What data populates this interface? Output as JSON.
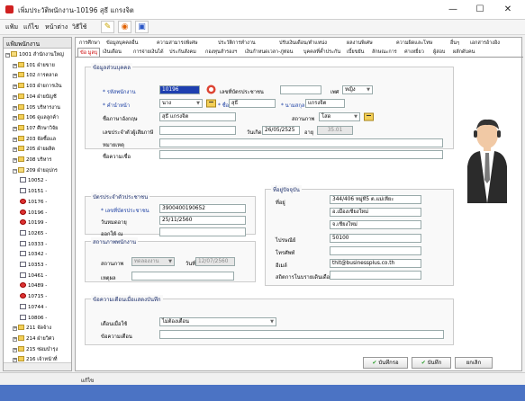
{
  "window": {
    "title": "เพิ่มประวัติพนักงาน-10196 สุธี แกรงจิต",
    "minimize": "—",
    "maximize": "☐",
    "close": "✕"
  },
  "menubar": {
    "items": [
      "แฟ้ม",
      "แก้ไข",
      "หน้าต่าง",
      "วิธีใช้"
    ]
  },
  "tree": {
    "header": "แฟ้มพนักงาน",
    "nodes": [
      {
        "label": "1001 สำนักงานใหญ่",
        "icon": "folder-open-icon"
      },
      {
        "label": "101 ฝ่ายขาย",
        "icon": "folder-icon"
      },
      {
        "label": "102 การตลาด",
        "icon": "folder-icon"
      },
      {
        "label": "103 ฝ่ายการเงิน",
        "icon": "folder-icon"
      },
      {
        "label": "104 ฝ่ายบัญชี",
        "icon": "folder-icon"
      },
      {
        "label": "105 บริหารงาน",
        "icon": "folder-icon"
      },
      {
        "label": "106 ดูแลลูกค้า",
        "icon": "folder-icon"
      },
      {
        "label": "107 ศึกษาวิจัย",
        "icon": "folder-icon"
      },
      {
        "label": "203 จัดซื้อแล",
        "icon": "folder-icon"
      },
      {
        "label": "205 ฝ่ายผลิต",
        "icon": "folder-icon"
      },
      {
        "label": "208 บริหาร",
        "icon": "folder-icon"
      },
      {
        "label": "209 ฝ่ายอุปกร",
        "icon": "folder-open-icon"
      },
      {
        "label": "10052 -",
        "icon": "doc-icon"
      },
      {
        "label": "10151 -",
        "icon": "doc-icon"
      },
      {
        "label": "10176 -",
        "icon": "docred-icon"
      },
      {
        "label": "10196 -",
        "icon": "docred-icon"
      },
      {
        "label": "10199 -",
        "icon": "docred-icon"
      },
      {
        "label": "10265 -",
        "icon": "doc-icon"
      },
      {
        "label": "10333 -",
        "icon": "doc-icon"
      },
      {
        "label": "10342 -",
        "icon": "doc-icon"
      },
      {
        "label": "10353 -",
        "icon": "doc-icon"
      },
      {
        "label": "10461 -",
        "icon": "doc-icon"
      },
      {
        "label": "10489 -",
        "icon": "docred-icon"
      },
      {
        "label": "10715 -",
        "icon": "docred-icon"
      },
      {
        "label": "10744 -",
        "icon": "doc-icon"
      },
      {
        "label": "10806 -",
        "icon": "doc-icon"
      },
      {
        "label": "211 จัดจ้าง",
        "icon": "folder-icon"
      },
      {
        "label": "214 ฝ่ายวิศว",
        "icon": "folder-icon"
      },
      {
        "label": "215 ซ่อมบำรุง",
        "icon": "folder-icon"
      },
      {
        "label": "216 เจ้าหน้าที่",
        "icon": "folder-icon"
      }
    ]
  },
  "tabs_row1": [
    "การศึกษา",
    "ข้อมูลบุคคลอื่น",
    "ความสามารถพิเศษ",
    "ประวัติการทำงาน",
    "ปรับเงินเดือน/ตำแหน่ง",
    "ผลงานพิเศษ",
    "ความผิดและโทษ",
    "อื่นๆ",
    "เอกสารอ้างอิง"
  ],
  "tabs_row2": [
    "ข้อ มูลบุ",
    "เงินเดือน",
    "การจ่ายเงินได้",
    "ประกันสังคม",
    "กองทุนสำรองฯ",
    "เงินกำหนดเวลา-ภู่ท่อน",
    "บุคคลที่ค้ำประกัน",
    "เบี้ยขยัน",
    "ลักษณะการ",
    "ค่าเหยี่ยว",
    "ผู้สอบ",
    "ผลักดับคน"
  ],
  "personal": {
    "title": "ข้อมูลส่วนบุคคล",
    "emp_code_label": "* รหัสพนักงาน",
    "emp_code": "10196",
    "idcard_label": "เลขที่บัตรประชาชน",
    "idcard": "",
    "sex_label": "เพศ",
    "sex": "หญิง",
    "prefix_label": "* คำนำหน้า",
    "prefix": "นาง",
    "firstname_label": "* ชื่อ",
    "firstname": "สุธี",
    "lastname_label": "* นามสกุล",
    "lastname": "แกรงจิต",
    "nickname_label": "ชื่อภาษาอังกฤษ",
    "nickname": "สุธี แกรงจิต",
    "status_label": "สถานภาพ",
    "status": "โสด",
    "taxid_label": "เลขประจำตัวผู้เสียภาษี",
    "taxid": "",
    "birth_label": "วันเกิด",
    "birth": "26/05/2525",
    "age_label": "อายุ",
    "age": "35.01",
    "note_label": "หมายเหตุ",
    "note": "",
    "search_label": "ชื่อความเชื่อ",
    "search": ""
  },
  "idcard_group": {
    "title": "บัตรประจำตัวประชาชน",
    "no_label": "* เลขที่บัตรประชาชน",
    "no": "3900400190652",
    "issue_label": "วันหมดอายุ",
    "issue": "25/11/2560",
    "issuer_label": "ออกให้ ณ",
    "issuer": ""
  },
  "address": {
    "title": "ที่อยู่ปัจจุบัน",
    "addr_label": "ที่อยู่",
    "addr1": "344/406 หมู่ที่5 ต.แม่เหียะ",
    "addr2": "อ.เมืองเชียงใหม่",
    "addr3": "จ.เชียงใหม่",
    "zip_label": "ไปรษณีย์",
    "zip": "50100",
    "phone_label": "โทรศัพท์",
    "phone": "",
    "email_label": "อีเมล์",
    "email": "thit@businessplus.co.th",
    "web_label": "สถิตการโนบรายเดินเดือน",
    "web": ""
  },
  "work": {
    "title": "สถานภาพพนักงาน",
    "status_label": "สถานภาพ",
    "status": "ทดลองงาน",
    "date_label": "วันที่",
    "date": "12/07/2560",
    "note_label": "เหตุผล",
    "note": ""
  },
  "remind": {
    "title": "ข้อความเตือนเมื่อแสดงบันทึก",
    "type_label": "เตือนเมื่อใช้",
    "type": "ไม่ต้องเตือน",
    "msg_label": "ข้อความเตือน",
    "msg": ""
  },
  "buttons": {
    "save_new": "บันทึกรอ",
    "save": "บันทึก",
    "cancel": "ยกเลิก"
  },
  "statusbar": {
    "text": "แก้ไข"
  }
}
